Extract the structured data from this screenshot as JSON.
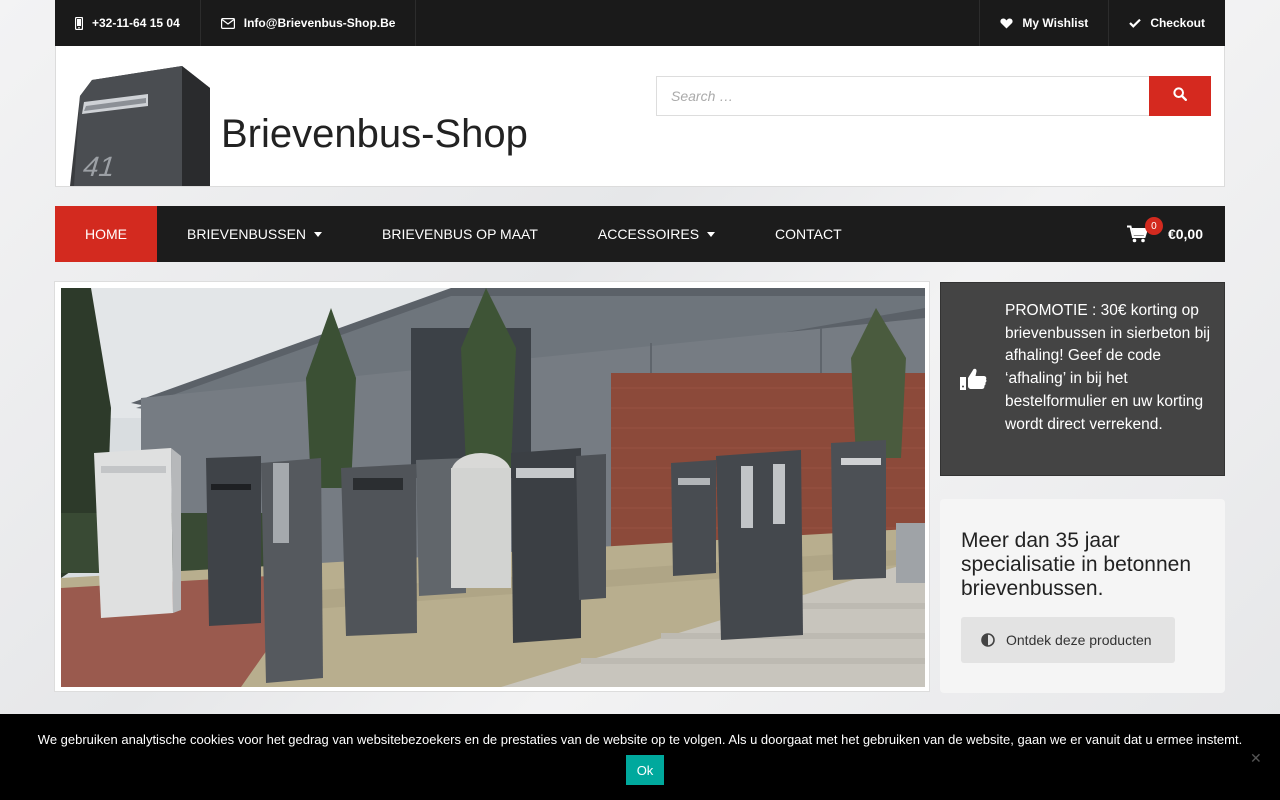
{
  "topbar": {
    "phone": "+32-11-64 15 04",
    "email": "Info@Brievenbus-Shop.Be",
    "wishlist": "My Wishlist",
    "checkout": "Checkout"
  },
  "header": {
    "site_title": "Brievenbus-Shop",
    "logo_number": "41",
    "search_placeholder": "Search …"
  },
  "nav": {
    "items": [
      {
        "label": "HOME",
        "active": true
      },
      {
        "label": "BRIEVENBUSSEN",
        "dropdown": true
      },
      {
        "label": "BRIEVENBUS OP MAAT"
      },
      {
        "label": "ACCESSOIRES",
        "dropdown": true
      },
      {
        "label": "CONTACT"
      }
    ],
    "cart_count": "0",
    "cart_total": "€0,00"
  },
  "promo": {
    "text": "PROMOTIE : 30€ korting op brievenbussen in sierbeton bij afhaling! Geef de code ‘afhaling’ in bij het bestelformulier en uw korting wordt direct verrekend."
  },
  "spec": {
    "heading": "Meer dan 35 jaar specialisatie in betonnen brievenbussen.",
    "button": "Ontdek deze producten"
  },
  "cookie": {
    "message": "We gebruiken analytische cookies voor het gedrag van websitebezoekers en de prestaties van de website op te volgen. Als u doorgaat met het gebruiken van de website, gaan we er vanuit dat u ermee instemt.",
    "ok": "Ok",
    "close": "✕"
  },
  "colors": {
    "accent": "#d32a1f",
    "dark": "#1c1c1c",
    "cookie_button": "#00a99d"
  },
  "icons": [
    "mobile-phone-icon",
    "envelope-icon",
    "heart-icon",
    "check-icon",
    "search-icon",
    "shopping-cart-icon",
    "thumbs-up-icon",
    "half-circle-icon"
  ]
}
